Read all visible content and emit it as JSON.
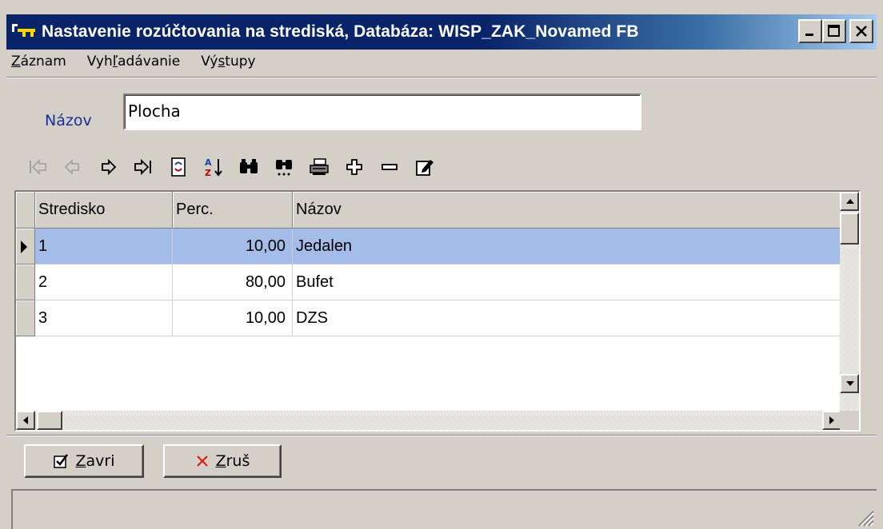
{
  "window": {
    "title": "Nastavenie rozúčtovania na strediská,  Databáza: WISP_ZAK_Novamed FB"
  },
  "menu": {
    "items": [
      {
        "pre": "",
        "key": "Z",
        "post": "áznam"
      },
      {
        "pre": "Vyh",
        "key": "ľ",
        "post": "adávanie"
      },
      {
        "pre": "Vý",
        "key": "s",
        "post": "tupy"
      }
    ]
  },
  "form": {
    "name_label": "Názov",
    "name_value": "Plocha"
  },
  "toolbar": {
    "icons": [
      "first-icon",
      "prev-icon",
      "next-icon",
      "last-icon",
      "refresh-icon",
      "sort-icon",
      "find-icon",
      "find-next-icon",
      "print-icon",
      "add-icon",
      "delete-icon",
      "edit-icon"
    ]
  },
  "grid": {
    "columns": [
      "Stredisko",
      "Perc.",
      "Názov"
    ],
    "rows": [
      {
        "stredisko": "1",
        "perc": "10,00",
        "nazov": "Jedalen"
      },
      {
        "stredisko": "2",
        "perc": "80,00",
        "nazov": "Bufet"
      },
      {
        "stredisko": "3",
        "perc": "10,00",
        "nazov": "DZS"
      }
    ],
    "selected_row": 1,
    "selection_color": "#a4bce8"
  },
  "buttons": {
    "close": {
      "pre": "",
      "key": "Z",
      "post": "avri"
    },
    "cancel": {
      "pre": "",
      "key": "Z",
      "post": "ruš"
    }
  },
  "colors": {
    "title_bar": "#0a246a",
    "face": "#d4d0c8",
    "label_blue": "#1b2e9c"
  }
}
